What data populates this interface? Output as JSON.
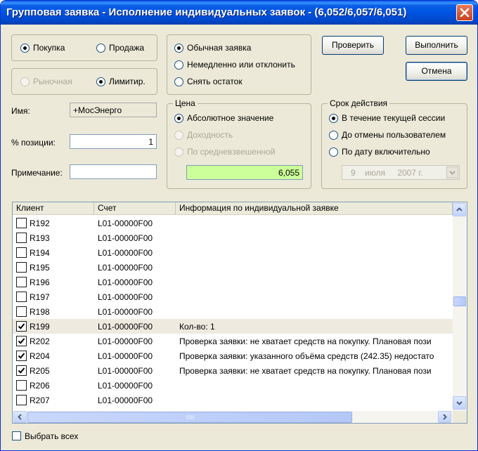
{
  "window": {
    "title": "Групповая заявка - Исполнение индивидуальных заявок - (6,052/6,057/6,051)"
  },
  "side": {
    "buy": "Покупка",
    "sell": "Продажа",
    "selected": "buy"
  },
  "order_kind": {
    "market": "Рыночная",
    "limit": "Лимитир.",
    "selected": "limit"
  },
  "exec_type": {
    "options": [
      "Обычная заявка",
      "Немедленно или отклонить",
      "Снять остаток"
    ],
    "selected": 0
  },
  "buttons": {
    "check": "Проверить",
    "execute": "Выполнить",
    "cancel": "Отмена"
  },
  "fields": {
    "name_label": "Имя:",
    "name_value": "+МосЭнерго",
    "position_label": "% позиции:",
    "position_value": "1",
    "note_label": "Примечание:",
    "note_value": ""
  },
  "price": {
    "title": "Цена",
    "options": [
      "Абсолютное значение",
      "Доходность",
      "По средневзвешенной"
    ],
    "selected": 0,
    "value": "6,055"
  },
  "validity": {
    "title": "Срок действия",
    "options": [
      "В течение текущей сессии",
      "До отмены пользователем",
      "По дату включительно"
    ],
    "selected": 0,
    "date_day": "9",
    "date_month": "июля",
    "date_year": "2007 г."
  },
  "table": {
    "columns": [
      "Клиент",
      "Счет",
      "Информация по индивидуальной заявке"
    ],
    "rows": [
      {
        "client": "R192",
        "account": "L01-00000F00",
        "info": "",
        "checked": false
      },
      {
        "client": "R193",
        "account": "L01-00000F00",
        "info": "",
        "checked": false
      },
      {
        "client": "R194",
        "account": "L01-00000F00",
        "info": "",
        "checked": false
      },
      {
        "client": "R195",
        "account": "L01-00000F00",
        "info": "",
        "checked": false
      },
      {
        "client": "R196",
        "account": "L01-00000F00",
        "info": "",
        "checked": false
      },
      {
        "client": "R197",
        "account": "L01-00000F00",
        "info": "",
        "checked": false
      },
      {
        "client": "R198",
        "account": "L01-00000F00",
        "info": "",
        "checked": false
      },
      {
        "client": "R199",
        "account": "L01-00000F00",
        "info": "Кол-во: 1",
        "checked": true
      },
      {
        "client": "R202",
        "account": "L01-00000F00",
        "info": "Проверка заявки: не хватает средств на покупку. Плановая пози",
        "checked": true
      },
      {
        "client": "R204",
        "account": "L01-00000F00",
        "info": "Проверка заявки: указанного объёма средств (242.35) недостато",
        "checked": true
      },
      {
        "client": "R205",
        "account": "L01-00000F00",
        "info": "Проверка заявки: не хватает средств на покупку. Плановая пози",
        "checked": true
      },
      {
        "client": "R206",
        "account": "L01-00000F00",
        "info": "",
        "checked": false
      },
      {
        "client": "R207",
        "account": "L01-00000F00",
        "info": "",
        "checked": false
      }
    ],
    "selected_row": 7
  },
  "select_all_label": "Выбрать всех"
}
